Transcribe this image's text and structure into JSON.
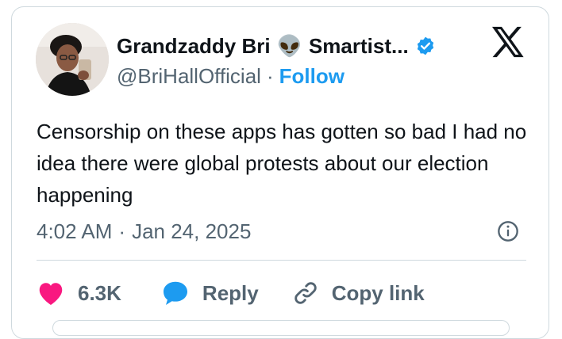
{
  "tweet": {
    "author": {
      "display_name": "Grandzaddy Bri",
      "name_emoji": "👽",
      "name_suffix": "Smartist...",
      "handle": "@BriHallOfficial",
      "verified": true
    },
    "follow_label": "Follow",
    "separator": "·",
    "text": "Censorship on these apps has gotten so bad I had no idea there were global protests about our election happening",
    "time": "4:02 AM",
    "date": "Jan 24, 2025",
    "actions": {
      "like_count": "6.3K",
      "reply_label": "Reply",
      "copy_link_label": "Copy link"
    }
  },
  "icons": {
    "platform": "x-logo-icon",
    "verified": "verified-badge-icon",
    "like": "heart-icon",
    "reply": "speech-bubble-icon",
    "copy_link": "link-icon",
    "info": "info-icon"
  },
  "colors": {
    "accent": "#1d9bf0",
    "like": "#f91880",
    "text": "#0f1419",
    "secondary_text": "#536471",
    "border": "#cfd9de"
  }
}
